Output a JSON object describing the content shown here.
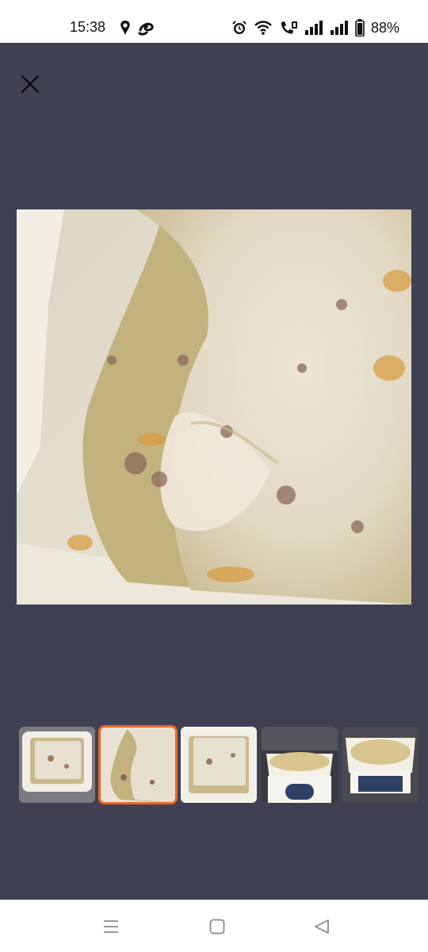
{
  "status": {
    "time": "15:38",
    "battery": "88%"
  },
  "icons": {
    "close": "close-icon",
    "alarm": "alarm-icon",
    "wifi": "wifi-icon",
    "volte": "volte-call-icon",
    "signal": "signal-icon",
    "battery": "battery-icon",
    "menu": "menu-icon",
    "home": "home-icon",
    "back": "back-icon"
  },
  "colors": {
    "viewer_background": "#3f4153",
    "selected_thumbnail_border": "#e8672a"
  },
  "gallery": {
    "thumbnail_count": 5,
    "selected_index": 1
  }
}
